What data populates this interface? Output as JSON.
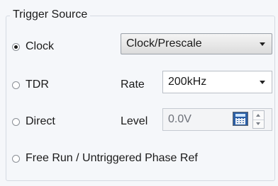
{
  "group": {
    "title": "Trigger Source"
  },
  "options": {
    "clock": {
      "label": "Clock",
      "selected": true
    },
    "tdr": {
      "label": "TDR",
      "selected": false
    },
    "direct": {
      "label": "Direct",
      "selected": false
    },
    "free_run": {
      "label": "Free Run / Untriggered Phase Ref",
      "selected": false
    }
  },
  "clock_mode": {
    "value": "Clock/Prescale"
  },
  "rate": {
    "label": "Rate",
    "value": "200kHz"
  },
  "level": {
    "label": "Level",
    "value": "0.0V",
    "icon": "calculator-icon"
  }
}
